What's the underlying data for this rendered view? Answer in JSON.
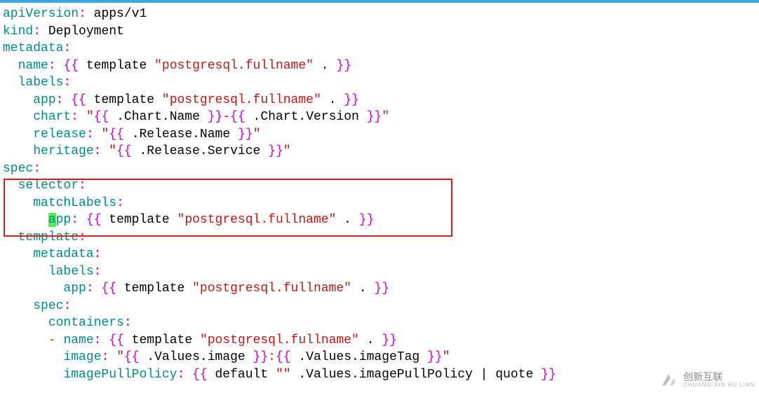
{
  "code": {
    "l1": {
      "key": "apiVersion",
      "colon": ":",
      "val": "apps/v1"
    },
    "l2": {
      "key": "kind",
      "colon": ":",
      "val": "Deployment"
    },
    "l3": {
      "key": "metadata",
      "colon": ":"
    },
    "l4": {
      "key": "name",
      "colon": ":",
      "open": "{{",
      "tmpl": "template",
      "str": "\"postgresql.fullname\"",
      "dot": ".",
      "close": "}}"
    },
    "l5": {
      "key": "labels",
      "colon": ":"
    },
    "l6": {
      "key": "app",
      "colon": ":",
      "open": "{{",
      "tmpl": "template",
      "str": "\"postgresql.fullname\"",
      "dot": ".",
      "close": "}}"
    },
    "l7": {
      "key": "chart",
      "colon": ":",
      "q1": "\"",
      "o1": "{{",
      "e1": ".Chart.Name",
      "c1": "}}",
      "dash": "-",
      "o2": "{{",
      "e2": ".Chart.Version",
      "c2": "}}",
      "q2": "\""
    },
    "l8": {
      "key": "release",
      "colon": ":",
      "q1": "\"",
      "o1": "{{",
      "e1": ".Release.Name",
      "c1": "}}",
      "q2": "\""
    },
    "l9": {
      "key": "heritage",
      "colon": ":",
      "q1": "\"",
      "o1": "{{",
      "e1": ".Release.Service",
      "c1": "}}",
      "q2": "\""
    },
    "l10": {
      "key": "spec",
      "colon": ":"
    },
    "l11": {
      "key": "selector",
      "colon": ":"
    },
    "l12": {
      "key": "matchLabels",
      "colon": ":"
    },
    "l13": {
      "cursor": "a",
      "rest": "pp",
      "colon": ":",
      "open": "{{",
      "tmpl": "template",
      "str": "\"postgresql.fullname\"",
      "dot": ".",
      "close": "}}"
    },
    "l14": {
      "key": "template",
      "colon": ":"
    },
    "l15": {
      "key": "metadata",
      "colon": ":"
    },
    "l16": {
      "key": "labels",
      "colon": ":"
    },
    "l17": {
      "key": "app",
      "colon": ":",
      "open": "{{",
      "tmpl": "template",
      "str": "\"postgresql.fullname\"",
      "dot": ".",
      "close": "}}"
    },
    "l18": {
      "key": "spec",
      "colon": ":"
    },
    "l19": {
      "key": "containers",
      "colon": ":"
    },
    "l20": {
      "dash": "-",
      "key": "name",
      "colon": ":",
      "open": "{{",
      "tmpl": "template",
      "str": "\"postgresql.fullname\"",
      "dot": ".",
      "close": "}}"
    },
    "l21": {
      "key": "image",
      "colon": ":",
      "q1": "\"",
      "o1": "{{",
      "e1": ".Values.image",
      "c1": "}}",
      "sep": ":",
      "o2": "{{",
      "e2": ".Values.imageTag",
      "c2": "}}",
      "q2": "\""
    },
    "l22": {
      "key": "imagePullPolicy",
      "colon": ":",
      "open": "{{",
      "def": "default",
      "empty": "\"\"",
      "path": ".Values.imagePullPolicy",
      "pipe": "|",
      "quote": "quote",
      "close": "}}"
    }
  },
  "watermark": {
    "main": "创新互联",
    "sub": "CHUANG XIN HU LIAN"
  }
}
